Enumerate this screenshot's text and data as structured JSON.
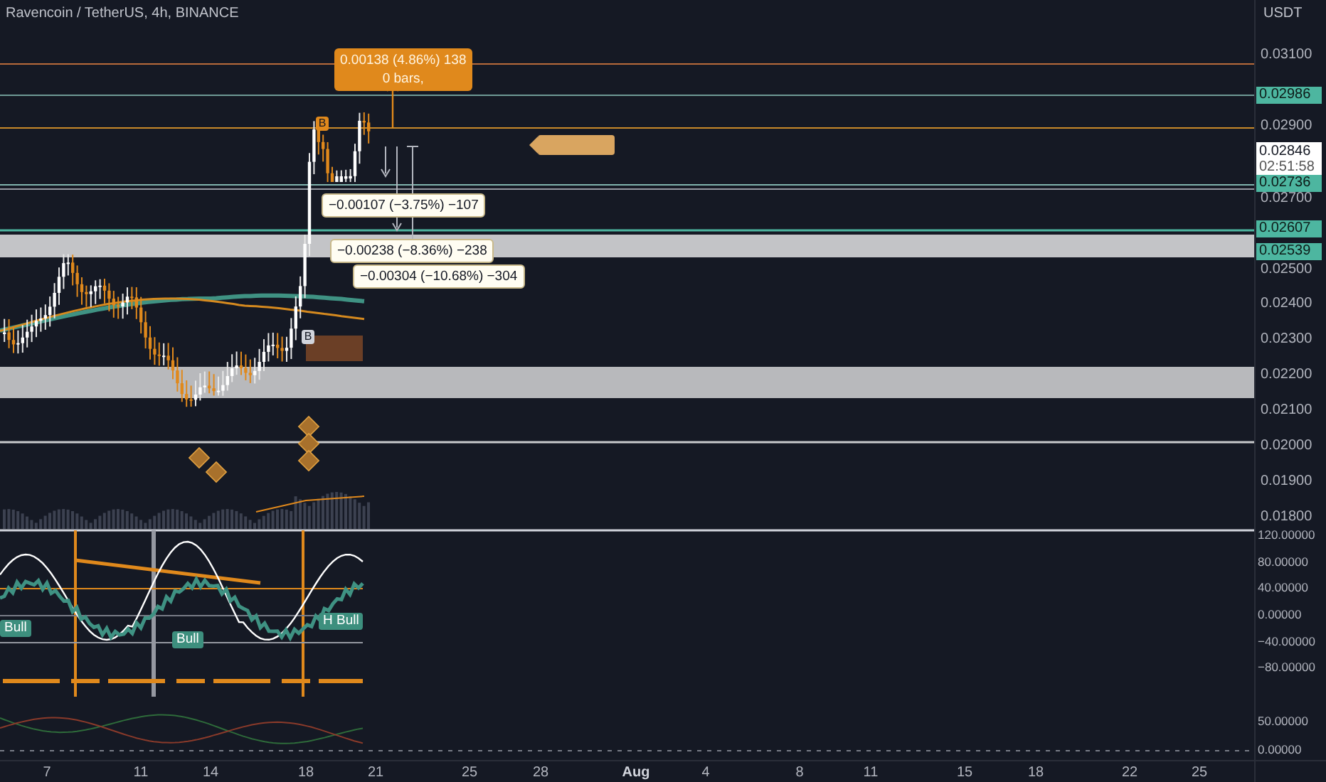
{
  "header": {
    "title": "Ravencoin / TetherUS, 4h, BINANCE"
  },
  "price_axis": {
    "currency": "USDT",
    "ticks": [
      "0.03100",
      "0.02900",
      "0.02700",
      "0.02500",
      "0.02400",
      "0.02300",
      "0.02200",
      "0.02100",
      "0.02000",
      "0.01900",
      "0.01800"
    ]
  },
  "price_tags": [
    {
      "kind": "level",
      "value": "0.02986"
    },
    {
      "kind": "last",
      "value": "0.02846",
      "countdown": "02:51:58"
    },
    {
      "kind": "level",
      "value": "0.02736"
    },
    {
      "kind": "level",
      "value": "0.02607"
    },
    {
      "kind": "level",
      "value": "0.02539"
    }
  ],
  "measurements": [
    {
      "kind": "up",
      "text": "0.00138 (4.86%) 138",
      "subtext": "0 bars,"
    },
    {
      "kind": "down",
      "text": "−0.00107 (−3.75%) −107"
    },
    {
      "kind": "down",
      "text": "−0.00238 (−8.36%) −238"
    },
    {
      "kind": "down",
      "text": "−0.00304 (−10.68%) −304"
    }
  ],
  "signal_markers": [
    {
      "text": "B",
      "color": "#e0891c"
    },
    {
      "text": "B",
      "color": "#d1d4dc"
    }
  ],
  "oscillator_axis": {
    "ticks": [
      "120.00000",
      "80.00000",
      "40.00000",
      "0.00000",
      "−40.00000",
      "−80.00000"
    ]
  },
  "divergence_labels": [
    "Bull",
    "Bull",
    "H Bull"
  ],
  "lower_axis": {
    "ticks": [
      "50.00000",
      "0.00000"
    ]
  },
  "time_axis": [
    {
      "kind": "day",
      "label": "7"
    },
    {
      "kind": "day",
      "label": "11"
    },
    {
      "kind": "day",
      "label": "14"
    },
    {
      "kind": "day",
      "label": "18"
    },
    {
      "kind": "day",
      "label": "21"
    },
    {
      "kind": "day",
      "label": "25"
    },
    {
      "kind": "day",
      "label": "28"
    },
    {
      "kind": "month",
      "label": "Aug"
    },
    {
      "kind": "day",
      "label": "4"
    },
    {
      "kind": "day",
      "label": "8"
    },
    {
      "kind": "day",
      "label": "11"
    },
    {
      "kind": "day",
      "label": "15"
    },
    {
      "kind": "day",
      "label": "18"
    },
    {
      "kind": "day",
      "label": "22"
    },
    {
      "kind": "day",
      "label": "25"
    }
  ]
}
